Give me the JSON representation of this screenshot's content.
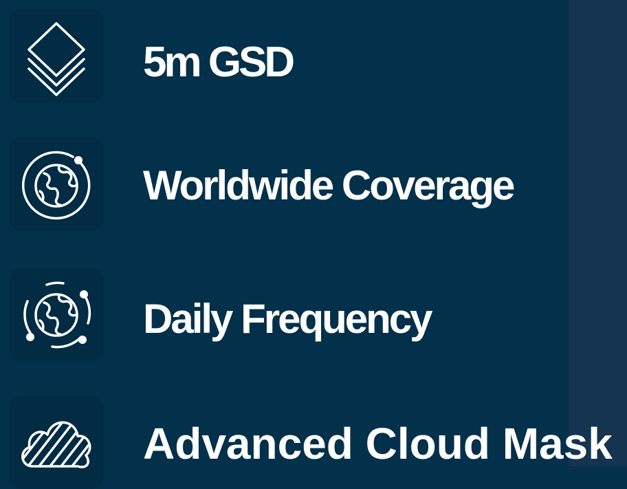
{
  "features": [
    {
      "label": "5m GSD",
      "icon": "layers-icon"
    },
    {
      "label": "Worldwide Coverage",
      "icon": "globe-orbit-icon"
    },
    {
      "label": "Daily Frequency",
      "icon": "globe-orbits-icon"
    },
    {
      "label": "Advanced Cloud Mask",
      "icon": "hatched-cloud-icon"
    }
  ],
  "colors": {
    "background": "#03304a",
    "background_right": "#143450",
    "text": "#ffffff",
    "icon_stroke": "#ffffff"
  }
}
